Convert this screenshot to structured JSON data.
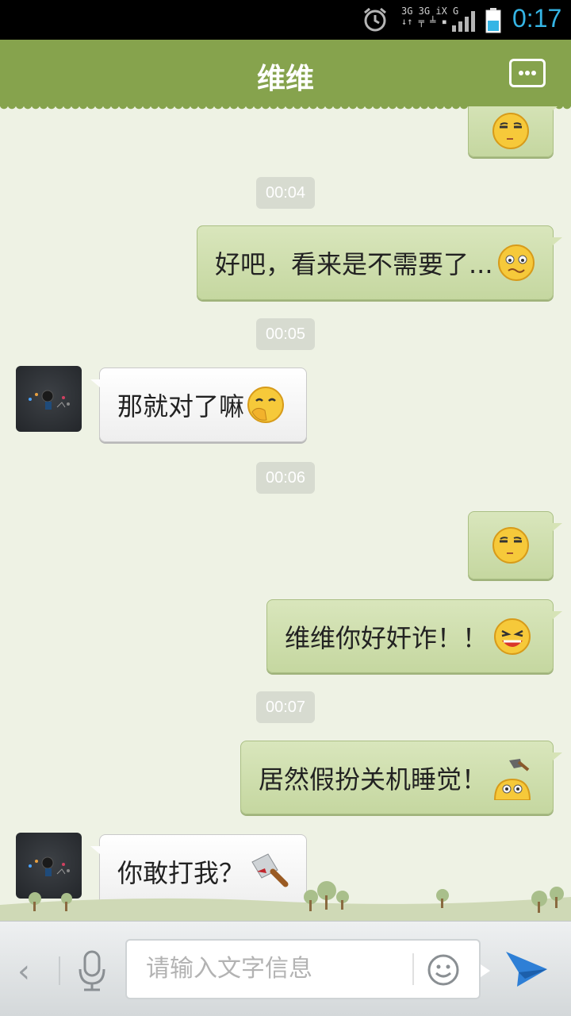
{
  "status_bar": {
    "time": "0:17",
    "network": {
      "top": "3G 3G iX G",
      "bottom": "↓↑ ╤ ╧ ▪"
    },
    "icons": [
      "alarm-icon",
      "signal-icon",
      "battery-icon"
    ]
  },
  "header": {
    "title": "维维",
    "menu_icon": "more-dots-icon"
  },
  "messages": [
    {
      "type": "timestamp",
      "text": "00:04"
    },
    {
      "type": "sent",
      "text": "好吧，看来是不需要了...",
      "emoji": "worried-face"
    },
    {
      "type": "timestamp",
      "text": "00:05"
    },
    {
      "type": "received",
      "text": "那就对了嘛",
      "emoji": "giggle-face"
    },
    {
      "type": "timestamp",
      "text": "00:06"
    },
    {
      "type": "sent",
      "text": "",
      "emoji": "smug-face"
    },
    {
      "type": "sent",
      "text": "维维你好奸诈！！",
      "emoji": "laughing-face"
    },
    {
      "type": "timestamp",
      "text": "00:07"
    },
    {
      "type": "sent",
      "text": "居然假扮关机睡觉！",
      "emoji": "hammer-hit-face"
    },
    {
      "type": "received",
      "text": "你敢打我？",
      "emoji": "cleaver-knife"
    }
  ],
  "input_bar": {
    "placeholder": "请输入文字信息",
    "back_icon": "chevron-left-icon",
    "mic_icon": "microphone-icon",
    "emoji_icon": "smiley-icon",
    "send_icon": "send-arrow-icon"
  },
  "colors": {
    "header_bg": "#86a34d",
    "chat_bg": "#eef2e4",
    "sent_bubble": "#cddcaa",
    "received_bubble": "#f7f7f7",
    "time_accent": "#35b5e5",
    "send_blue": "#2e7fd6"
  }
}
